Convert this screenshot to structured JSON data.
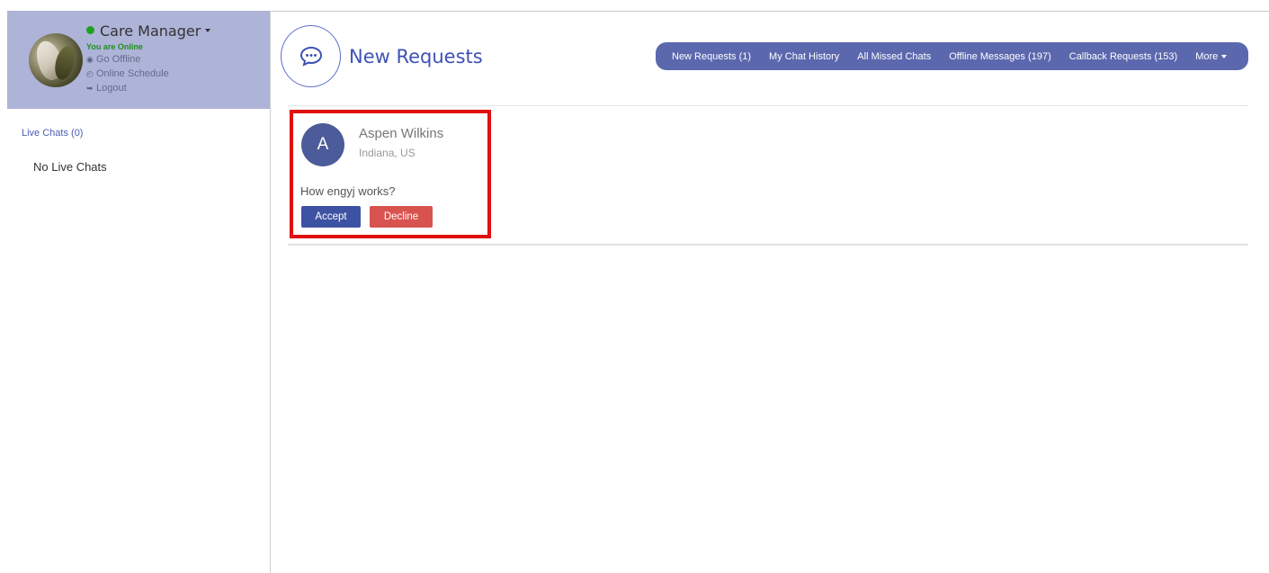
{
  "sidebar": {
    "profile": {
      "name": "Care Manager",
      "status_text": "You are Online",
      "links": [
        {
          "icon": "eye-slash-icon",
          "glyph": "◉",
          "label": "Go Offline"
        },
        {
          "icon": "clock-icon",
          "glyph": "◴",
          "label": "Online Schedule"
        },
        {
          "icon": "sign-out-icon",
          "glyph": "➥",
          "label": "Logout"
        }
      ],
      "status_color": "#1fa01f"
    },
    "live_chats_label": "Live Chats (0)",
    "no_live_chats": "No Live Chats"
  },
  "header": {
    "icon": "chat-bubble-icon",
    "title": "New Requests"
  },
  "navbar": {
    "items": [
      {
        "label": "New Requests (1)"
      },
      {
        "label": "My Chat History"
      },
      {
        "label": "All Missed Chats"
      },
      {
        "label": "Offline Messages (197)"
      },
      {
        "label": "Callback Requests (153)"
      },
      {
        "label": "More"
      }
    ],
    "bg_color": "#5c68ae"
  },
  "request": {
    "initial": "A",
    "name": "Aspen Wilkins",
    "location": "Indiana, US",
    "message": "How engyj works?",
    "accept_label": "Accept",
    "decline_label": "Decline",
    "highlight_color": "#e01010"
  }
}
